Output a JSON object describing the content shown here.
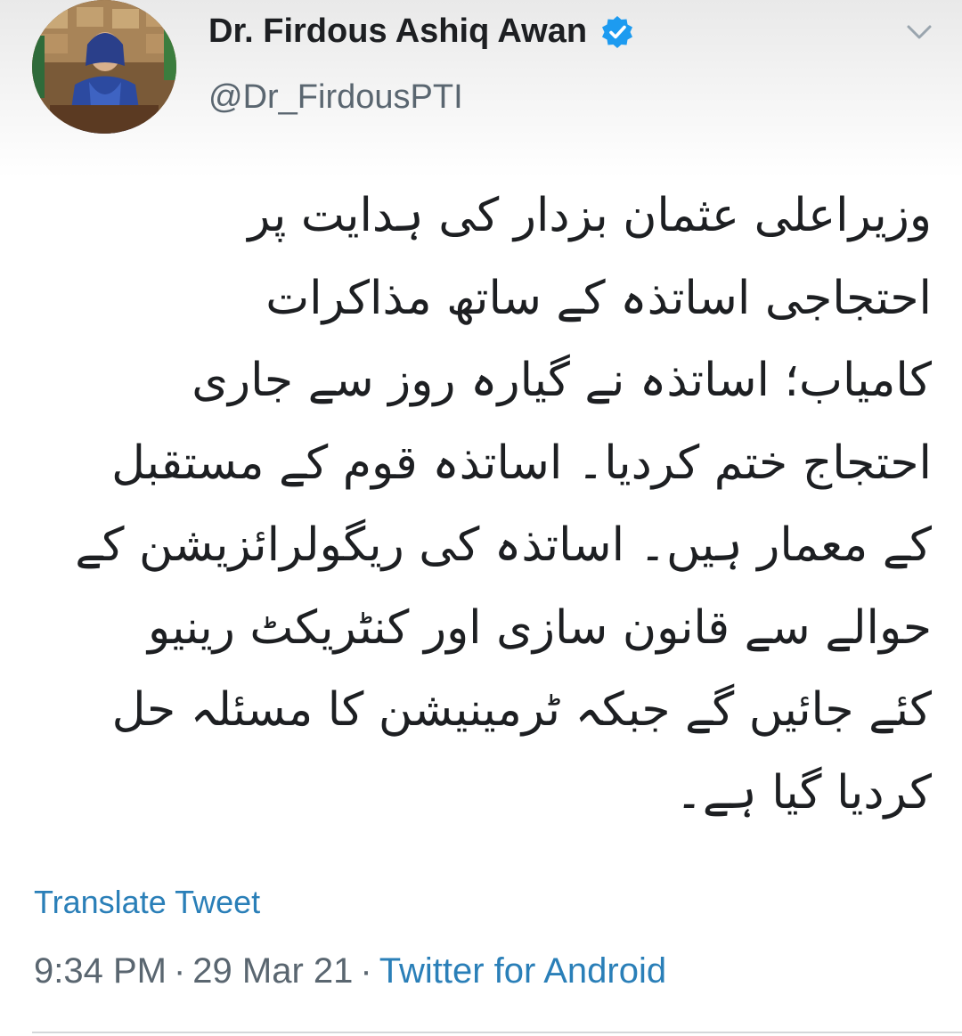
{
  "tweet": {
    "author": {
      "display_name": "Dr. Firdous Ashiq Awan",
      "handle": "@Dr_FirdousPTI",
      "verified": true
    },
    "lines": [
      "وزیراعلی عثمان بزدار کی ہدایت پر",
      "احتجاجی اساتذہ کے ساتھ مذاکرات",
      "کامیاب؛ اساتذہ نے گیارہ روز سے جاری",
      "احتجاج ختم کردیا۔ اساتذہ قوم کے مستقبل",
      "کے معمار ہیں۔ اساتذہ کی ریگولرائزیشن کے",
      "حوالے سے قانون سازی اور کنٹریکٹ رینیو",
      "کئے جائیں گے جبکہ ٹرمینیشن کا مسئلہ حل",
      "کردیا گیا ہے۔"
    ],
    "translate_label": "Translate Tweet",
    "time": "9:34 PM",
    "separator": "·",
    "date": "29 Mar 21",
    "source": "Twitter for Android"
  },
  "colors": {
    "link": "#2a7fb8",
    "verified_badge": "#1d9bf0",
    "muted_text": "#5a6670"
  },
  "icons": {
    "verified": "verified-badge-icon",
    "menu": "chevron-down-icon"
  }
}
